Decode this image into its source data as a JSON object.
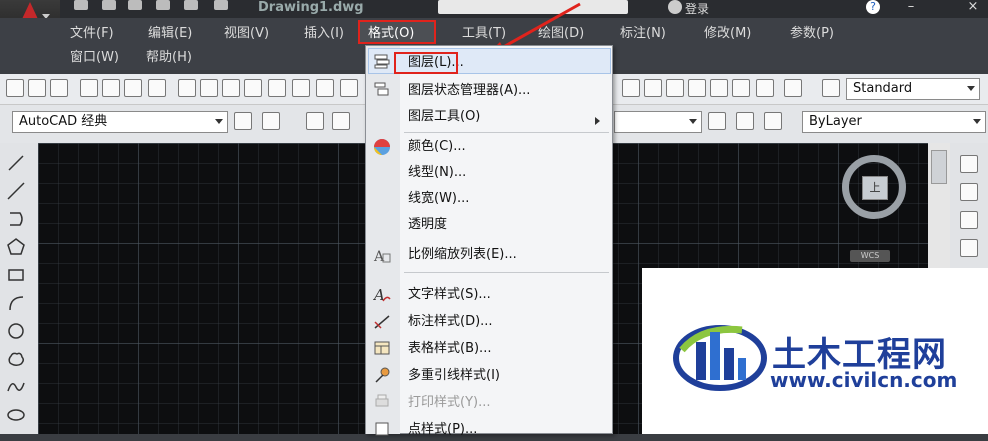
{
  "window": {
    "doc_title": "Drawing1.dwg",
    "user_label": "登录",
    "help_symbol": "?",
    "minimize": "–",
    "close": "×"
  },
  "menubar": {
    "items": [
      {
        "label": "文件(F)"
      },
      {
        "label": "编辑(E)"
      },
      {
        "label": "视图(V)"
      },
      {
        "label": "插入(I)"
      },
      {
        "label": "格式(O)"
      },
      {
        "label": "工具(T)"
      },
      {
        "label": "绘图(D)"
      },
      {
        "label": "标注(N)"
      },
      {
        "label": "修改(M)"
      },
      {
        "label": "参数(P)"
      },
      {
        "label": "窗口(W)"
      },
      {
        "label": "帮助(H)"
      }
    ]
  },
  "toolbar": {
    "text_style_value": "Standard",
    "workspace_value": "AutoCAD 经典",
    "layer_value": "ByLayer"
  },
  "format_menu": {
    "items": [
      {
        "label": "图层(L)...",
        "icon": "layers-icon",
        "enabled": true
      },
      {
        "label": "图层状态管理器(A)...",
        "icon": "layer-state-icon",
        "enabled": true
      },
      {
        "label": "图层工具(O)",
        "icon": "",
        "enabled": true,
        "submenu": true
      },
      {
        "label": "颜色(C)...",
        "icon": "color-wheel-icon",
        "enabled": true
      },
      {
        "label": "线型(N)...",
        "icon": "",
        "enabled": true
      },
      {
        "label": "线宽(W)...",
        "icon": "",
        "enabled": true
      },
      {
        "label": "透明度",
        "icon": "",
        "enabled": true
      },
      {
        "label": "比例缩放列表(E)...",
        "icon": "scale-list-icon",
        "enabled": true
      },
      {
        "label": "文字样式(S)...",
        "icon": "text-style-icon",
        "enabled": true
      },
      {
        "label": "标注样式(D)...",
        "icon": "dimension-style-icon",
        "enabled": true
      },
      {
        "label": "表格样式(B)...",
        "icon": "table-style-icon",
        "enabled": true
      },
      {
        "label": "多重引线样式(I)",
        "icon": "multileader-style-icon",
        "enabled": true
      },
      {
        "label": "打印样式(Y)...",
        "icon": "plot-style-icon",
        "enabled": false
      },
      {
        "label": "点样式(P)...",
        "icon": "point-style-icon",
        "enabled": true
      }
    ]
  },
  "viewcube": {
    "face_label": "上",
    "wcs_label": "WCS"
  },
  "watermark": {
    "title": "土木工程网",
    "url": "www.civilcn.com"
  },
  "colors": {
    "highlight_red": "#e0231c",
    "watermark_blue": "#1f3f9a",
    "watermark_green": "#8cc63f"
  }
}
